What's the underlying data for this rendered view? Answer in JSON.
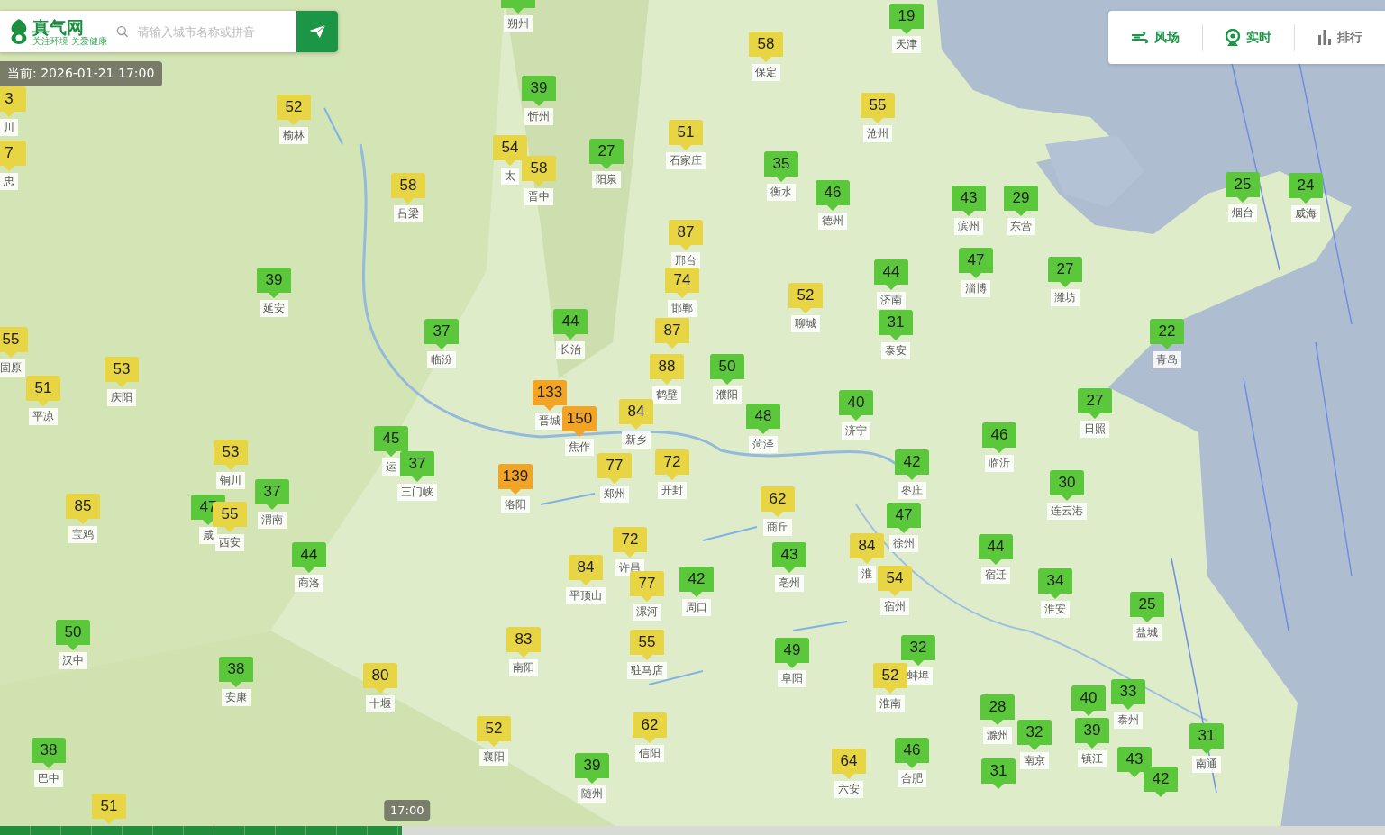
{
  "search": {
    "logo": "真气网",
    "slogan": "关注环境 关爱健康",
    "placeholder": "请输入城市名称或拼音"
  },
  "current_time": "当前: 2026-01-21 17:00",
  "toolbar": [
    {
      "label": "风场",
      "kind": "wind",
      "on": true
    },
    {
      "label": "实时",
      "kind": "camera",
      "on": true
    },
    {
      "label": "排行",
      "kind": "ranking",
      "on": false
    }
  ],
  "markers": [
    {
      "city": "朔州",
      "color": "#5ac83a"
    },
    {
      "aqi": "19",
      "city": "天津",
      "color": "#5ac83a"
    },
    {
      "aqi": "58",
      "city": "保定",
      "color": "#e8d544"
    },
    {
      "aqi": "39",
      "city": "忻州",
      "color": "#5ac83a"
    },
    {
      "aqi": "3",
      "city": "川",
      "color": "#e8d544"
    },
    {
      "aqi": "52",
      "city": "榆林",
      "color": "#e8d544"
    },
    {
      "aqi": "55",
      "city": "沧州",
      "color": "#e8d544"
    },
    {
      "aqi": "51",
      "city": "石家庄",
      "color": "#e8d544"
    },
    {
      "aqi": "7",
      "city": "忠",
      "color": "#e8d544"
    },
    {
      "aqi": "54",
      "city": "太",
      "color": "#e8d544"
    },
    {
      "aqi": "27",
      "city": "阳泉",
      "color": "#5ac83a"
    },
    {
      "aqi": "58",
      "city": "晋中",
      "color": "#e8d544"
    },
    {
      "aqi": "35",
      "city": "衡水",
      "color": "#5ac83a"
    },
    {
      "aqi": "58",
      "city": "吕梁",
      "color": "#e8d544"
    },
    {
      "aqi": "46",
      "city": "德州",
      "color": "#5ac83a"
    },
    {
      "aqi": "43",
      "city": "滨州",
      "color": "#5ac83a"
    },
    {
      "aqi": "29",
      "city": "东营",
      "color": "#5ac83a"
    },
    {
      "aqi": "25",
      "city": "烟台",
      "color": "#5ac83a"
    },
    {
      "aqi": "24",
      "city": "威海",
      "color": "#5ac83a"
    },
    {
      "aqi": "87",
      "city": "邢台",
      "color": "#e8d544"
    },
    {
      "aqi": "39",
      "city": "延安",
      "color": "#5ac83a"
    },
    {
      "aqi": "74",
      "city": "邯郸",
      "color": "#e8d544"
    },
    {
      "aqi": "44",
      "city": "济南",
      "color": "#5ac83a"
    },
    {
      "aqi": "47",
      "city": "淄博",
      "color": "#5ac83a"
    },
    {
      "aqi": "27",
      "city": "潍坊",
      "color": "#5ac83a"
    },
    {
      "aqi": "52",
      "city": "聊城",
      "color": "#e8d544"
    },
    {
      "aqi": "55",
      "city": "固原",
      "color": "#e8d544"
    },
    {
      "aqi": "37",
      "city": "临汾",
      "color": "#5ac83a"
    },
    {
      "aqi": "44",
      "city": "长治",
      "color": "#5ac83a"
    },
    {
      "aqi": "87",
      "color": "#e8d544"
    },
    {
      "aqi": "31",
      "city": "泰安",
      "color": "#5ac83a"
    },
    {
      "aqi": "22",
      "city": "青岛",
      "color": "#5ac83a"
    },
    {
      "aqi": "53",
      "city": "庆阳",
      "color": "#e8d544"
    },
    {
      "aqi": "88",
      "city": "鹤壁",
      "color": "#e8d544"
    },
    {
      "aqi": "50",
      "city": "濮阳",
      "color": "#5ac83a"
    },
    {
      "aqi": "51",
      "city": "平凉",
      "color": "#e8d544"
    },
    {
      "aqi": "133",
      "city": "晋城",
      "color": "#f4a424"
    },
    {
      "aqi": "40",
      "city": "济宁",
      "color": "#5ac83a"
    },
    {
      "aqi": "27",
      "city": "日照",
      "color": "#5ac83a"
    },
    {
      "aqi": "150",
      "city": "焦作",
      "color": "#f4a424"
    },
    {
      "aqi": "84",
      "city": "新乡",
      "color": "#e8d544"
    },
    {
      "aqi": "48",
      "city": "菏泽",
      "color": "#5ac83a"
    },
    {
      "aqi": "45",
      "city": "运",
      "color": "#5ac83a"
    },
    {
      "aqi": "46",
      "city": "临沂",
      "color": "#5ac83a"
    },
    {
      "aqi": "53",
      "city": "铜川",
      "color": "#e8d544"
    },
    {
      "aqi": "37",
      "city": "三门峡",
      "color": "#5ac83a"
    },
    {
      "aqi": "77",
      "city": "郑州",
      "color": "#e8d544"
    },
    {
      "aqi": "72",
      "city": "开封",
      "color": "#e8d544"
    },
    {
      "aqi": "42",
      "city": "枣庄",
      "color": "#5ac83a"
    },
    {
      "aqi": "139",
      "city": "洛阳",
      "color": "#f4a424"
    },
    {
      "aqi": "30",
      "city": "连云港",
      "color": "#5ac83a"
    },
    {
      "aqi": "37",
      "city": "渭南",
      "color": "#5ac83a"
    },
    {
      "aqi": "62",
      "city": "商丘",
      "color": "#e8d544"
    },
    {
      "aqi": "85",
      "city": "宝鸡",
      "color": "#e8d544"
    },
    {
      "aqi": "47",
      "city": "咸",
      "color": "#5ac83a"
    },
    {
      "aqi": "55",
      "city": "西安",
      "color": "#e8d544"
    },
    {
      "aqi": "47",
      "city": "徐州",
      "color": "#5ac83a"
    },
    {
      "aqi": "72",
      "city": "许昌",
      "color": "#e8d544"
    },
    {
      "aqi": "84",
      "city": "淮",
      "color": "#e8d544"
    },
    {
      "aqi": "44",
      "city": "宿迁",
      "color": "#5ac83a"
    },
    {
      "aqi": "44",
      "city": "商洛",
      "color": "#5ac83a"
    },
    {
      "aqi": "43",
      "city": "亳州",
      "color": "#5ac83a"
    },
    {
      "aqi": "84",
      "city": "平顶山",
      "color": "#e8d544"
    },
    {
      "aqi": "77",
      "city": "漯河",
      "color": "#e8d544"
    },
    {
      "aqi": "42",
      "city": "周口",
      "color": "#5ac83a"
    },
    {
      "aqi": "54",
      "city": "宿州",
      "color": "#e8d544"
    },
    {
      "aqi": "34",
      "city": "淮安",
      "color": "#5ac83a"
    },
    {
      "aqi": "25",
      "city": "盐城",
      "color": "#5ac83a"
    },
    {
      "aqi": "50",
      "city": "汉中",
      "color": "#5ac83a"
    },
    {
      "aqi": "83",
      "city": "南阳",
      "color": "#e8d544"
    },
    {
      "aqi": "55",
      "city": "驻马店",
      "color": "#e8d544"
    },
    {
      "aqi": "49",
      "city": "阜阳",
      "color": "#5ac83a"
    },
    {
      "aqi": "32",
      "city": "蚌埠",
      "color": "#5ac83a"
    },
    {
      "aqi": "38",
      "city": "安康",
      "color": "#5ac83a"
    },
    {
      "aqi": "80",
      "city": "十堰",
      "color": "#e8d544"
    },
    {
      "aqi": "52",
      "city": "淮南",
      "color": "#e8d544"
    },
    {
      "aqi": "40",
      "color": "#5ac83a"
    },
    {
      "aqi": "33",
      "city": "泰州",
      "color": "#5ac83a"
    },
    {
      "aqi": "28",
      "city": "滁州",
      "color": "#5ac83a"
    },
    {
      "aqi": "52",
      "city": "襄阳",
      "color": "#e8d544"
    },
    {
      "aqi": "62",
      "city": "信阳",
      "color": "#e8d544"
    },
    {
      "aqi": "32",
      "city": "南京",
      "color": "#5ac83a"
    },
    {
      "aqi": "39",
      "city": "镇江",
      "color": "#5ac83a"
    },
    {
      "aqi": "31",
      "city": "南通",
      "color": "#5ac83a"
    },
    {
      "aqi": "38",
      "city": "巴中",
      "color": "#5ac83a"
    },
    {
      "aqi": "46",
      "city": "合肥",
      "color": "#5ac83a"
    },
    {
      "aqi": "39",
      "city": "随州",
      "color": "#5ac83a"
    },
    {
      "aqi": "64",
      "city": "六安",
      "color": "#e8d544"
    },
    {
      "aqi": "31",
      "color": "#5ac83a"
    },
    {
      "aqi": "43",
      "color": "#5ac83a"
    },
    {
      "aqi": "42",
      "color": "#5ac83a"
    },
    {
      "aqi": "51",
      "color": "#e8d544"
    }
  ],
  "timeline": {
    "time": "17:00",
    "level": 0.29
  }
}
